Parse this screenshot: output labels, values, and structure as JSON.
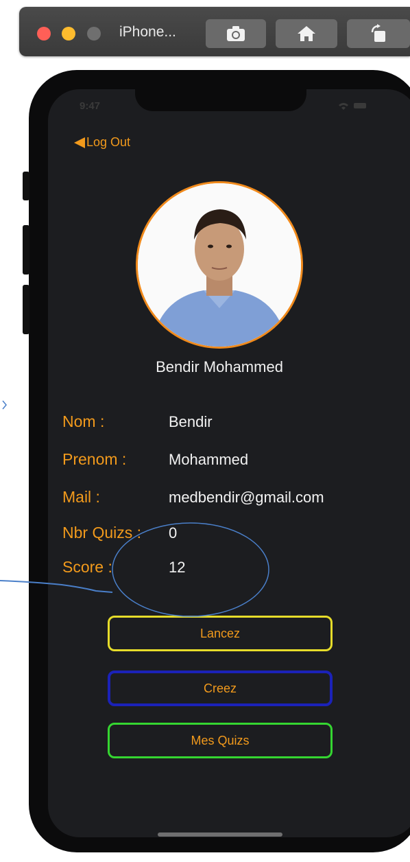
{
  "window": {
    "title": "iPhone...",
    "toolbar": [
      {
        "name": "screenshot-icon"
      },
      {
        "name": "home-icon"
      },
      {
        "name": "rotate-icon"
      }
    ]
  },
  "status_bar": {
    "time": "9:47"
  },
  "nav": {
    "back_label": "Log Out"
  },
  "profile": {
    "full_name": "Bendir Mohammed",
    "fields": [
      {
        "label": "Nom :",
        "value": "Bendir"
      },
      {
        "label": "Prenom :",
        "value": "Mohammed"
      },
      {
        "label": "Mail :",
        "value": "medbendir@gmail.com"
      },
      {
        "label": "Nbr Quizs :",
        "value": "0"
      },
      {
        "label": "Score :",
        "value": "12"
      }
    ]
  },
  "actions": {
    "lancez": "Lancez",
    "creez": "Creez",
    "mes_quizs": "Mes Quizs"
  },
  "colors": {
    "accent": "#f29a1c",
    "screen_bg": "#1c1d20",
    "lancez_border": "#e6dc2a",
    "creez_border": "#1b22b8",
    "mes_quizs_border": "#35d631",
    "annotation": "#4a7fc9"
  }
}
